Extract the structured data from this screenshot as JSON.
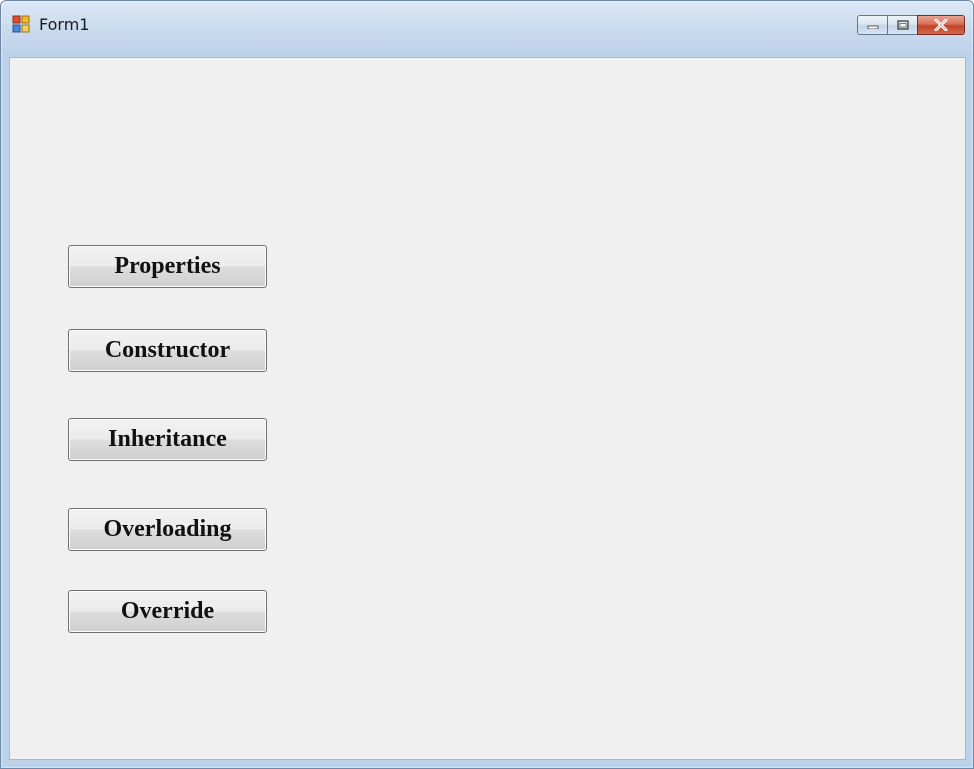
{
  "window": {
    "title": "Form1",
    "icon": "winforms-app-icon",
    "controls": {
      "minimize_icon": "minimize-icon",
      "maximize_icon": "maximize-icon",
      "close_icon": "close-icon"
    }
  },
  "buttons": {
    "properties": "Properties",
    "constructor": "Constructor",
    "inheritance": "Inheritance",
    "overloading": "Overloading",
    "override": "Override"
  },
  "colors": {
    "client_background": "#f0f0f0",
    "close_button": "#c2442a"
  }
}
